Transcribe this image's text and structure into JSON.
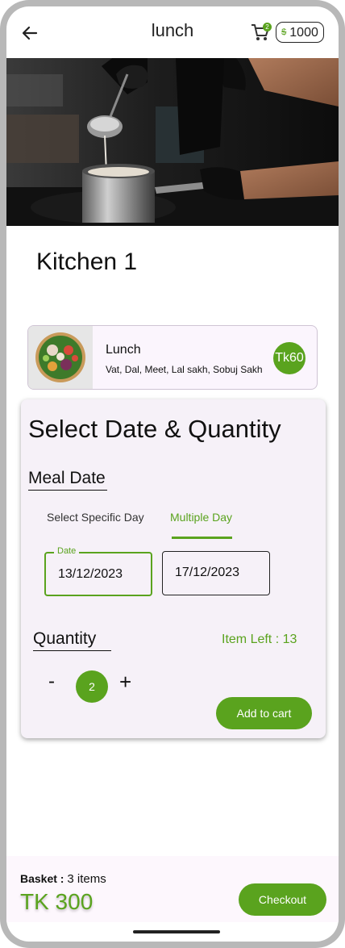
{
  "header": {
    "title": "lunch",
    "back_icon": "arrow-left-icon",
    "cart_icon": "shopping-cart-icon",
    "cart_count": "2",
    "wallet_balance": "1000",
    "wallet_icon": "coin-icon",
    "coin_symbol": "$"
  },
  "hero": {
    "image": "chef-cooking-photo"
  },
  "kitchen": {
    "name": "Kitchen 1"
  },
  "meal": {
    "title": "Lunch",
    "description": "Vat, Dal, Meet, Lal sakh, Sobuj Sakh",
    "price": "Tk60",
    "thumbnail": "salad-bowl-photo"
  },
  "select": {
    "title": "Select Date & Quantity",
    "meal_date_label": "Meal Date",
    "tabs": [
      {
        "label": "Select Specific Day",
        "active": false
      },
      {
        "label": "Multiple Day",
        "active": true
      }
    ],
    "date_field_label": "Date",
    "start_date": "13/12/2023",
    "end_date": "17/12/2023",
    "quantity_label": "Quantity",
    "items_left": "Item Left : 13",
    "minus": "-",
    "plus": "+",
    "quantity": "2",
    "add_to_cart": "Add to cart"
  },
  "basket": {
    "label": "Basket :",
    "items": "3 items",
    "total": "TK 300",
    "checkout": "Checkout"
  },
  "colors": {
    "accent": "#5aa31e",
    "card_bg": "#f6f1f8",
    "meal_card_bg": "#fbf5fd",
    "frame": "#b8b8b8"
  }
}
